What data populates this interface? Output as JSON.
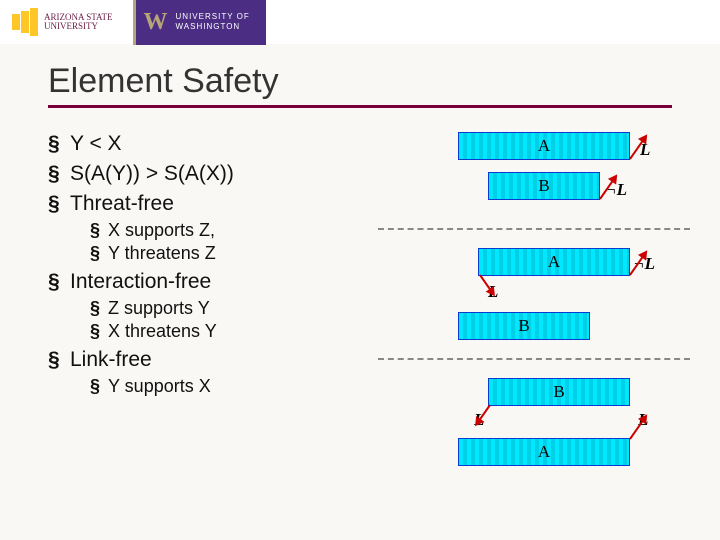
{
  "header": {
    "asu_name_l1": "ARIZONA STATE",
    "asu_name_l2": "UNIVERSITY",
    "uw_over": "UNIVERSITY OF",
    "uw_name": "WASHINGTON"
  },
  "title": "Element Safety",
  "bullets": {
    "b1": "Y < X",
    "b2": "S(A(Y)) > S(A(X))",
    "b3": "Threat-free",
    "b3_1": "X supports Z,",
    "b3_2": "Y threatens Z",
    "b4": "Interaction-free",
    "b4_1": "Z supports Y",
    "b4_2": "X threatens Y",
    "b5": "Link-free",
    "b5_1": "Y supports X"
  },
  "boxes": {
    "A": "A",
    "B": "B"
  },
  "labels": {
    "L": "L",
    "notL": "L"
  }
}
